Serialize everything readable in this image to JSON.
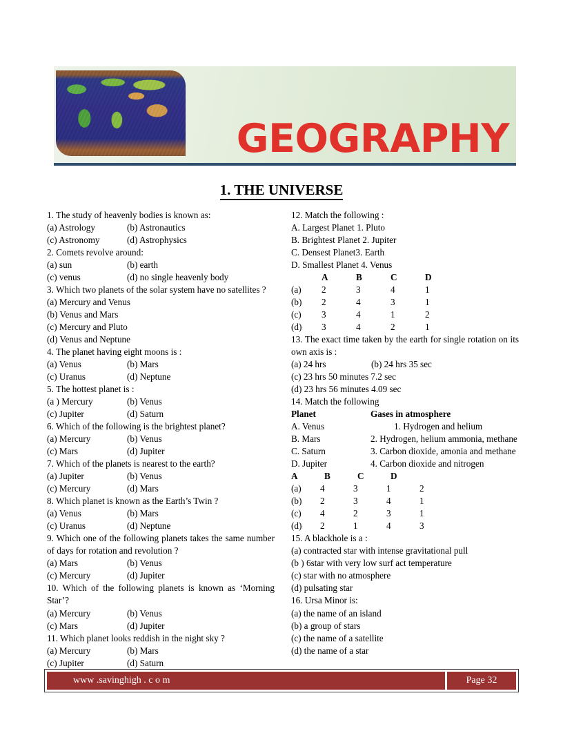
{
  "header": {
    "title": "GEOGRAPHY",
    "map_icon": "world-map-image",
    "title_color": "#e0322a",
    "rule_color": "#31506f"
  },
  "section": {
    "title": "1. THE UNIVERSE"
  },
  "left_column": [
    {
      "kind": "question",
      "text": "1.  The study of heavenly bodies is known as:",
      "options_paired": [
        [
          "(a) Astrology",
          "(b) Astronautics"
        ],
        [
          "(c) Astronomy",
          "(d) Astrophysics"
        ]
      ]
    },
    {
      "kind": "question",
      "text": "2. Comets revolve around:",
      "options_paired": [
        [
          "(a) sun",
          "(b) earth"
        ],
        [
          "(c) venus",
          "(d) no single heavenly body"
        ]
      ]
    },
    {
      "kind": "question",
      "text": "3. Which two planets of the solar system have no satellites ?",
      "options_stacked": [
        "(a) Mercury and Venus",
        "(b) Venus and Mars",
        "(c) Mercury and Pluto",
        "(d) Venus and Neptune"
      ]
    },
    {
      "kind": "question",
      "text": "4. The planet having eight moons is :",
      "options_paired": [
        [
          "(a) Venus",
          "(b) Mars"
        ],
        [
          "(c) Uranus",
          "(d) Neptune"
        ]
      ]
    },
    {
      "kind": "question",
      "text": "5. The hottest planet is :",
      "options_paired": [
        [
          "(a ) Mercury",
          "(b) Venus"
        ],
        [
          "(c) Jupiter",
          "(d) Saturn"
        ]
      ]
    },
    {
      "kind": "question",
      "text": "6.  Which of the following is the brightest planet?",
      "options_paired": [
        [
          "(a) Mercury",
          "(b) Venus"
        ],
        [
          "(c) Mars",
          "(d) Jupiter"
        ]
      ]
    },
    {
      "kind": "question",
      "text": "7. Which of the planets is nearest to the earth?",
      "options_paired": [
        [
          "(a) Jupiter",
          "(b) Venus"
        ],
        [
          "(c) Mercury",
          "(d) Mars"
        ]
      ]
    },
    {
      "kind": "question",
      "text": "8. Which planet is known as the Earth’s Twin ?",
      "options_paired": [
        [
          "(a) Venus",
          "(b) Mars"
        ],
        [
          "(c) Uranus",
          "(d) Neptune"
        ]
      ]
    },
    {
      "kind": "question",
      "justify": true,
      "text": "9.  Which  one  of  the  following  planets  takes  the  same number of days for rotation and revolution ?",
      "options_paired": [
        [
          "(a) Mars",
          "(b) Venus"
        ],
        [
          "(c) Mercury",
          "(d) Jupiter"
        ]
      ]
    },
    {
      "kind": "question",
      "justify": true,
      "text": "10.  Which  of  the  following  planets  is  known  as  ‘Morning Star’?",
      "options_paired": [
        [
          "(a) Mercury",
          "(b) Venus"
        ],
        [
          "(c) Mars",
          "(d) Jupiter"
        ]
      ]
    },
    {
      "kind": "question",
      "text": "11. Which planet looks reddish in the night sky ?",
      "options_paired": [
        [
          "(a) Mercury",
          "(b) Mars"
        ],
        [
          "(c) Jupiter",
          "(d) Saturn"
        ]
      ]
    }
  ],
  "q12": {
    "text": "12. Match the following :",
    "pairs": [
      "A. Largest Planet 1.  Pluto",
      "B. Brightest Planet 2. Jupiter",
      "C. Densest Planet3. Earth",
      "D. Smallest Planet 4. Venus"
    ],
    "table": {
      "headers": [
        "",
        "A",
        "B",
        "C",
        "D"
      ],
      "rows": [
        [
          "(a)",
          "2",
          "3",
          "4",
          "1"
        ],
        [
          "(b)",
          "2",
          "4",
          "3",
          "1"
        ],
        [
          "(c)",
          "3",
          "4",
          "1",
          "2"
        ],
        [
          "(d)",
          "3",
          "4",
          "2",
          "1"
        ]
      ]
    }
  },
  "q13": {
    "text": "13. The exact time taken by the earth for single rotation on its own axis is :",
    "options_paired": [
      [
        "(a) 24 hrs",
        "(b) 24 hrs 35 sec"
      ]
    ],
    "options_stacked": [
      "(c) 23 hrs 50 minutes 7.2 sec",
      "(d) 23 hrs 56 minutes 4.09 sec"
    ]
  },
  "q14": {
    "text": "14. Match the following",
    "head_left": "Planet",
    "head_right": "Gases in atmosphere",
    "pairs": [
      {
        "planet": "A. Venus",
        "gas": "1. Hydrogen and helium",
        "indent": true
      },
      {
        "planet": "B. Mars",
        "gas": "2. Hydrogen, helium ammonia, methane",
        "indent": false
      },
      {
        "planet": "C. Saturn",
        "gas": "3. Carbon dioxide,  amonia and methane",
        "indent": false
      },
      {
        "planet": "D. Jupiter",
        "gas": "4. Carbon dioxide and nitrogen",
        "indent": false
      }
    ],
    "table": {
      "headers": [
        "A",
        "B",
        "C",
        "D"
      ],
      "rows": [
        [
          "(a)",
          "4",
          "3",
          "1",
          "2"
        ],
        [
          "(b)",
          "2",
          "3",
          "4",
          "1"
        ],
        [
          "(c)",
          "4",
          "2",
          "3",
          "1"
        ],
        [
          "(d)",
          "2",
          "1",
          "4",
          "3"
        ]
      ]
    }
  },
  "q15": {
    "text": "15. A blackhole is a :",
    "options_stacked": [
      "(a) contracted star with intense gravitational pull",
      "(b ) 6star with very low surf act temperature",
      "(c) star with no atmosphere",
      "(d) pulsating star"
    ]
  },
  "q16": {
    "text": "16. Ursa Minor is:",
    "options_stacked": [
      "(a) the name of an island",
      "(b) a group of stars",
      "(c) the name of a satellite",
      "(d) the name of a star"
    ]
  },
  "footer": {
    "url": "www .savinghigh . c o m",
    "page": "Page 32",
    "background": "#9b3232"
  }
}
